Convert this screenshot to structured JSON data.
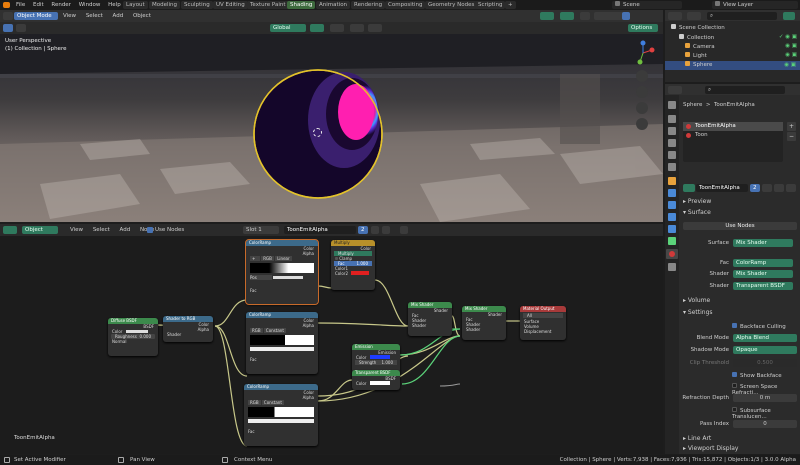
{
  "app": {
    "menu": [
      "File",
      "Edit",
      "Render",
      "Window",
      "Help"
    ],
    "workspaces": [
      "Layout",
      "Modeling",
      "Sculpting",
      "UV Editing",
      "Texture Paint",
      "Shading",
      "Animation",
      "Rendering",
      "Compositing",
      "Geometry Nodes",
      "Scripting",
      "+"
    ],
    "active_workspace": "Shading",
    "scene": "Scene",
    "view_layer": "View Layer"
  },
  "viewport": {
    "mode": "Object Mode",
    "menus": [
      "View",
      "Select",
      "Add",
      "Object"
    ],
    "transform": "Global",
    "options": "Options",
    "overlay_line1": "User Perspective",
    "overlay_line2": "(1) Collection | Sphere"
  },
  "node_editor": {
    "type": "Object",
    "menus": [
      "View",
      "Select",
      "Add",
      "Node"
    ],
    "use_nodes": "Use Nodes",
    "slot": "Slot 1",
    "material": "ToonEmitAlpha",
    "users": "2",
    "footer_label": "ToonEmitAlpha",
    "nodes": {
      "diffuse": {
        "title": "Diffuse BSDF",
        "out": "BSDF",
        "color": "Color",
        "roughness": "Roughness",
        "roughness_val": "0.000",
        "normal": "Normal"
      },
      "s2rgb": {
        "title": "Shader to RGB",
        "color": "Color",
        "alpha": "Alpha",
        "shader": "Shader"
      },
      "ramp1": {
        "title": "ColorRamp",
        "color": "Color",
        "alpha": "Alpha",
        "mode": "RGB",
        "interp": "Linear",
        "pos": "Pos",
        "fac": "Fac"
      },
      "multiply": {
        "title": "Multiply",
        "color": "Color",
        "op": "Multiply",
        "clamp": "Clamp",
        "fac": "Fac",
        "fac_val": "1.000",
        "c1": "Color1",
        "c2": "Color2"
      },
      "ramp2": {
        "title": "ColorRamp",
        "color": "Color",
        "alpha": "Alpha",
        "mode": "RGB",
        "interp": "Constant",
        "fac": "Fac"
      },
      "emission": {
        "title": "Emission",
        "out": "Emission",
        "color": "Color",
        "strength": "Strength",
        "strength_val": "1.000"
      },
      "mix1": {
        "title": "Mix Shader",
        "shader": "Shader",
        "fac": "Fac",
        "s1": "Shader",
        "s2": "Shader"
      },
      "mix2": {
        "title": "Mix Shader",
        "shader": "Shader",
        "fac": "Fac",
        "s1": "Shader",
        "s2": "Shader"
      },
      "output": {
        "title": "Material Output",
        "target": "All",
        "surface": "Surface",
        "volume": "Volume",
        "displacement": "Displacement"
      },
      "transparent": {
        "title": "Transparent BSDF",
        "out": "BSDF",
        "color": "Color"
      },
      "ramp3": {
        "title": "ColorRamp",
        "color": "Color",
        "alpha": "Alpha",
        "mode": "RGB",
        "interp": "Constant",
        "fac": "Fac"
      }
    }
  },
  "outliner": {
    "root": "Scene Collection",
    "collection": "Collection",
    "items": [
      "Camera",
      "Light",
      "Sphere"
    ]
  },
  "properties": {
    "object": "Sphere",
    "material": "ToonEmitAlpha",
    "slots": [
      "ToonEmitAlpha",
      "Toon"
    ],
    "mat_field": "ToonEmitAlpha",
    "users": "2",
    "preview": "Preview",
    "surface": "Surface",
    "use_nodes": "Use Nodes",
    "surface_label": "Surface",
    "surface_val": "Mix Shader",
    "fac_label": "Fac",
    "fac_val": "ColorRamp",
    "shader1_label": "Shader",
    "shader1_val": "Mix Shader",
    "shader2_label": "Shader",
    "shader2_val": "Transparent BSDF",
    "volume": "Volume",
    "settings": "Settings",
    "backface_culling": "Backface Culling",
    "blend_mode_label": "Blend Mode",
    "blend_mode": "Alpha Blend",
    "shadow_mode_label": "Shadow Mode",
    "shadow_mode": "Opaque",
    "clip_label": "Clip Threshold",
    "clip_val": "0.500",
    "show_backface": "Show Backface",
    "ssr": "Screen Space Refracti...",
    "refraction_label": "Refraction Depth",
    "refraction_val": "0 m",
    "subsurface": "Subsurface Translucen...",
    "pass_label": "Pass Index",
    "pass_val": "0",
    "line_art": "Line Art",
    "viewport_display": "Viewport Display"
  },
  "statusbar": {
    "left1": "Set Active Modifier",
    "left2": "Pan View",
    "left3": "Context Menu",
    "right": "Collection | Sphere | Verts:7,938 | Faces:7,936 | Tris:15,872 | Objects:1/3 | 3.0.0 Alpha"
  },
  "colors": {
    "accent": "#4772b3",
    "green": "#2f7a5e",
    "sel": "#e3c22b",
    "emission_blue": "#1e3cff",
    "multiply_red": "#e02020"
  }
}
